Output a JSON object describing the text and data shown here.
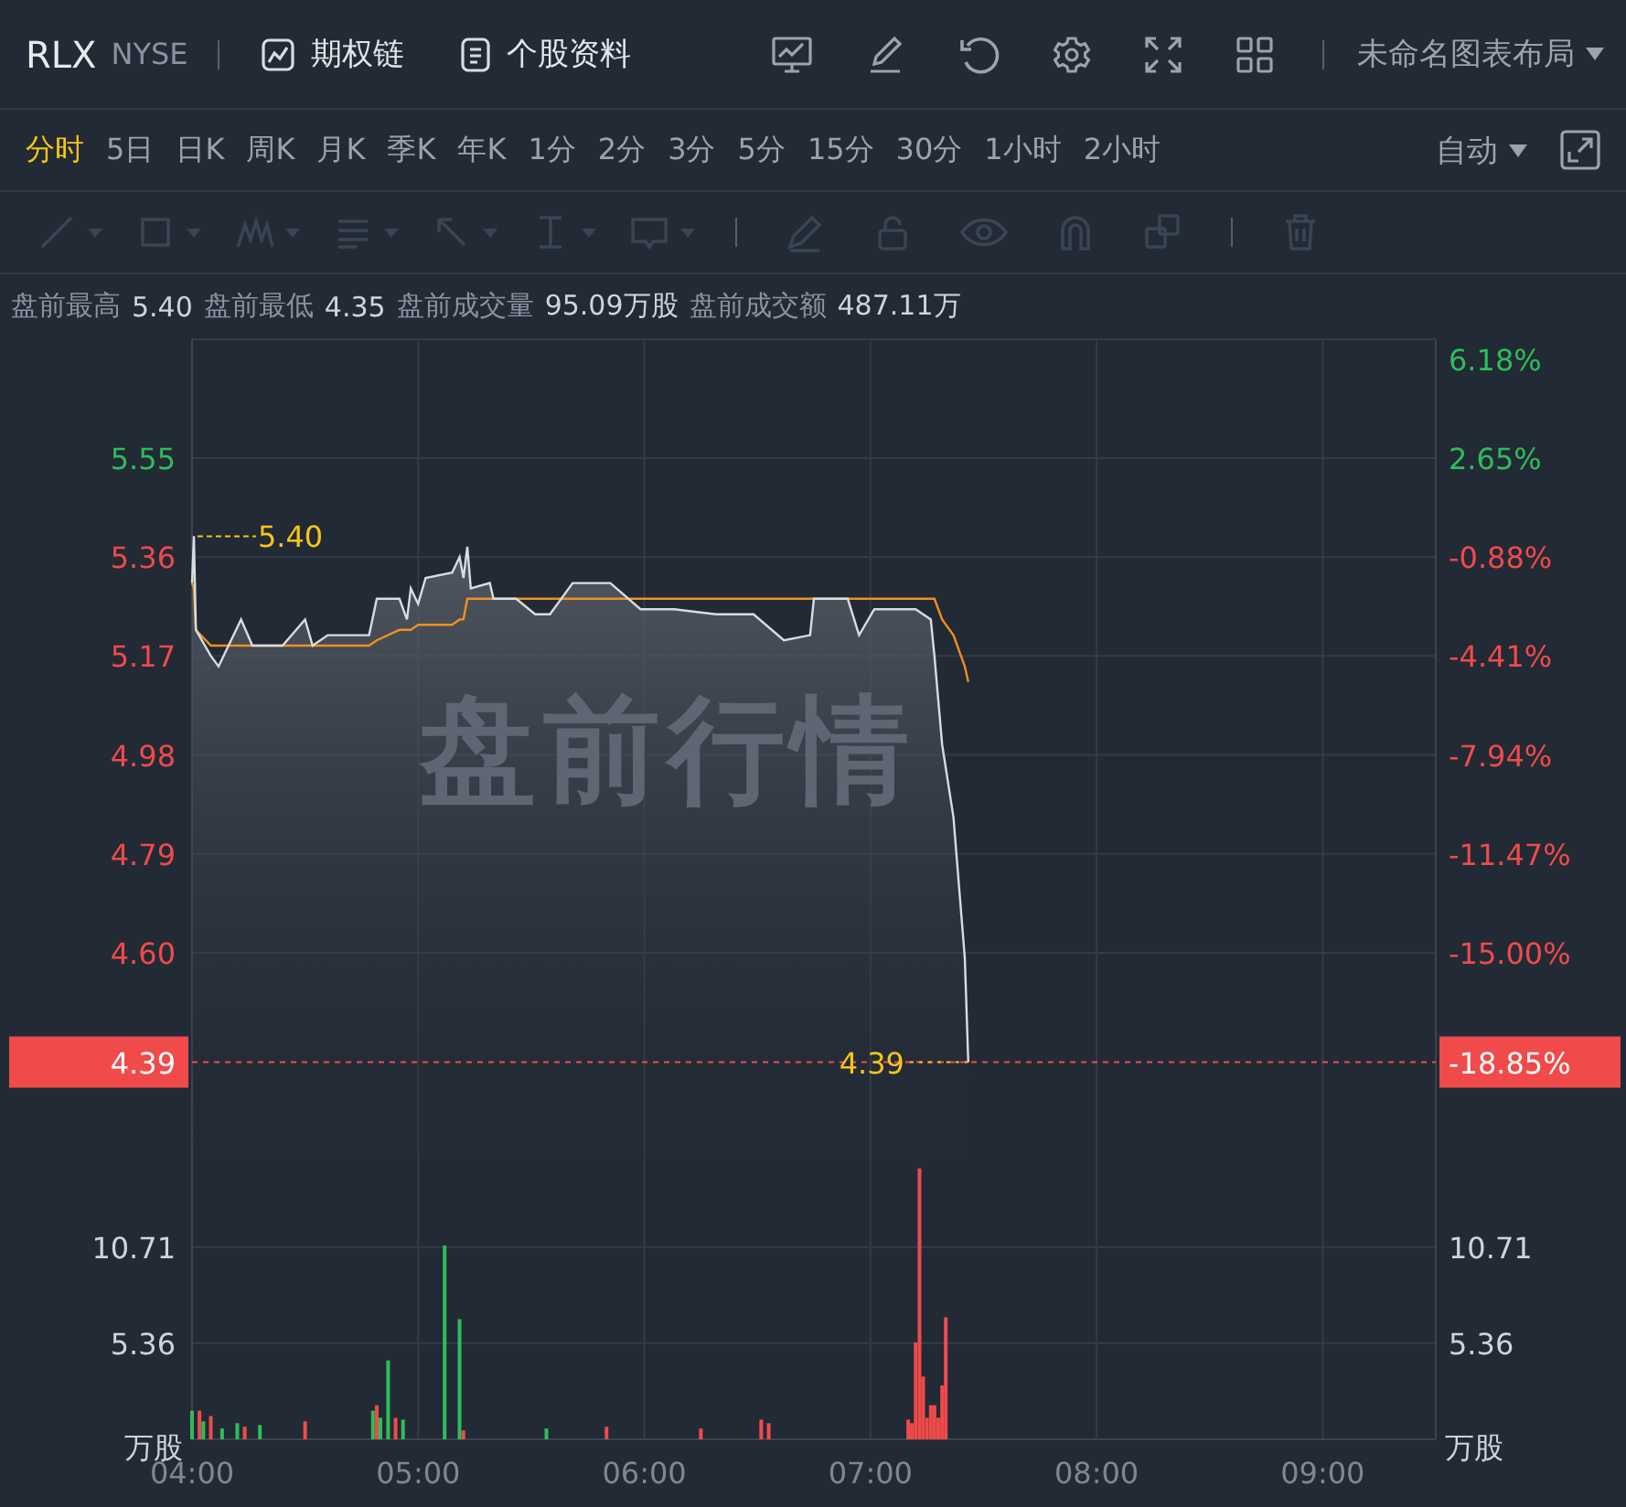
{
  "header": {
    "symbol": "RLX",
    "exchange": "NYSE",
    "links": [
      {
        "label": "期权链"
      },
      {
        "label": "个股资料"
      }
    ],
    "layout_menu": "未命名图表布局"
  },
  "periods": [
    {
      "label": "分时",
      "selected": true
    },
    {
      "label": "5日",
      "selected": false
    },
    {
      "label": "日K",
      "selected": false
    },
    {
      "label": "周K",
      "selected": false
    },
    {
      "label": "月K",
      "selected": false
    },
    {
      "label": "季K",
      "selected": false
    },
    {
      "label": "年K",
      "selected": false
    },
    {
      "label": "1分",
      "selected": false
    },
    {
      "label": "2分",
      "selected": false
    },
    {
      "label": "3分",
      "selected": false
    },
    {
      "label": "5分",
      "selected": false
    },
    {
      "label": "15分",
      "selected": false
    },
    {
      "label": "30分",
      "selected": false
    },
    {
      "label": "1小时",
      "selected": false
    },
    {
      "label": "2小时",
      "selected": false
    }
  ],
  "scale_menu": "自动",
  "drawing_toolbar": {
    "disabled": true
  },
  "stats": [
    {
      "label": "盘前最高",
      "value": "5.40"
    },
    {
      "label": "盘前最低",
      "value": "4.35"
    },
    {
      "label": "盘前成交量",
      "value": "95.09万股"
    },
    {
      "label": "盘前成交额",
      "value": "487.11万"
    }
  ],
  "price_chart": {
    "overlay_text": "盘前行情",
    "right_axis": [
      {
        "label": "6.18%",
        "color": "#2ebd5a"
      },
      {
        "label": "2.65%",
        "color": "#2ebd5a"
      },
      {
        "label": "-0.88%",
        "color": "#f04a4a"
      },
      {
        "label": "-4.41%",
        "color": "#f04a4a"
      },
      {
        "label": "-7.94%",
        "color": "#f04a4a"
      },
      {
        "label": "-11.47%",
        "color": "#f04a4a"
      },
      {
        "label": "-15.00%",
        "color": "#f04a4a"
      }
    ],
    "price_tag": {
      "price": "4.39",
      "change": "-18.85%"
    },
    "chart_data": {
      "type": "line",
      "x": [
        4,
        4.008,
        4.017,
        4.083,
        4.117,
        4.217,
        4.267,
        4.4,
        4.5,
        4.533,
        4.6,
        4.783,
        4.817,
        4.917,
        4.95,
        4.967,
        5,
        5.033,
        5.15,
        5.183,
        5.2,
        5.217,
        5.233,
        5.317,
        5.333,
        5.433,
        5.517,
        5.583,
        5.683,
        5.85,
        5.983,
        6.133,
        6.317,
        6.483,
        6.617,
        6.733,
        6.75,
        6.9,
        6.95,
        7.017,
        7.2,
        7.233,
        7.267,
        7.283,
        7.317,
        7.367,
        7.417,
        7.433
      ],
      "series": [
        {
          "color": "#d9dde2",
          "values": [
            5.31,
            5.4,
            5.22,
            5.17,
            5.15,
            5.24,
            5.19,
            5.19,
            5.24,
            5.19,
            5.21,
            5.21,
            5.28,
            5.28,
            5.24,
            5.3,
            5.27,
            5.32,
            5.33,
            5.36,
            5.32,
            5.38,
            5.3,
            5.31,
            5.28,
            5.28,
            5.25,
            5.25,
            5.31,
            5.31,
            5.26,
            5.26,
            5.25,
            5.25,
            5.2,
            5.21,
            5.28,
            5.28,
            5.21,
            5.26,
            5.26,
            5.25,
            5.24,
            5.17,
            5.0,
            4.86,
            4.59,
            4.39
          ]
        },
        {
          "color": "#f0901e",
          "values": [
            5.31,
            5.3,
            5.22,
            5.19,
            5.19,
            5.19,
            5.19,
            5.19,
            5.19,
            5.19,
            5.19,
            5.19,
            5.2,
            5.22,
            5.22,
            5.22,
            5.23,
            5.23,
            5.23,
            5.24,
            5.24,
            5.28,
            5.28,
            5.28,
            5.28,
            5.28,
            5.28,
            5.28,
            5.28,
            5.28,
            5.28,
            5.28,
            5.28,
            5.28,
            5.28,
            5.28,
            5.28,
            5.28,
            5.28,
            5.28,
            5.28,
            5.28,
            5.28,
            5.28,
            5.24,
            5.21,
            5.15,
            5.12
          ]
        }
      ],
      "xlim": [
        4,
        9.5
      ],
      "ylim": [
        4.21,
        5.78
      ],
      "grid": true,
      "ref_lines": [
        {
          "axis": "y",
          "value": 4.39,
          "color": "#f04a4a"
        }
      ],
      "yticks": [
        {
          "value": 5.55,
          "label": "5.55"
        },
        {
          "value": 5.36,
          "label": "5.36"
        },
        {
          "value": 5.17,
          "label": "5.17"
        },
        {
          "value": 4.98,
          "label": "4.98"
        },
        {
          "value": 4.79,
          "label": "4.79"
        },
        {
          "value": 4.6,
          "label": "4.60"
        }
      ],
      "annotations": [
        {
          "text": "5.40",
          "x": 4.008,
          "y": 5.4
        },
        {
          "text": "4.39",
          "x": 7.433,
          "y": 4.39
        }
      ]
    }
  },
  "volume_chart": {
    "unit_left": "万股",
    "unit_right": "万股",
    "chart_data": {
      "type": "bar",
      "x": [
        4,
        4.033,
        4.05,
        4.083,
        4.133,
        4.2,
        4.233,
        4.3,
        4.5,
        4.8,
        4.817,
        4.833,
        4.867,
        4.9,
        4.933,
        5.117,
        5.183,
        5.2,
        5.567,
        5.833,
        6.25,
        6.517,
        6.55,
        7.167,
        7.183,
        7.2,
        7.217,
        7.233,
        7.25,
        7.267,
        7.283,
        7.3,
        7.317,
        7.333
      ],
      "series": [
        {
          "color": "#f04a4a",
          "values": [
            null,
            1.6,
            null,
            1.3,
            null,
            null,
            0.7,
            null,
            1.0,
            null,
            1.9,
            null,
            null,
            1.2,
            null,
            null,
            null,
            0.5,
            null,
            0.7,
            0.6,
            1.1,
            0.9,
            1.1,
            0.9,
            5.4,
            15.1,
            3.5,
            1.2,
            1.9,
            1.9,
            1.2,
            3.0,
            6.8
          ]
        },
        {
          "color": "#2ebd5a",
          "values": [
            1.6,
            null,
            1.0,
            null,
            0.6,
            0.9,
            null,
            0.8,
            null,
            1.6,
            null,
            1.2,
            4.4,
            null,
            1.1,
            10.8,
            6.7,
            null,
            0.6,
            null,
            null,
            null,
            null,
            null,
            null,
            null,
            null,
            null,
            null,
            null,
            null,
            null,
            null,
            null
          ]
        }
      ],
      "xlim": [
        4,
        9.5
      ],
      "ylim": [
        0,
        15.8
      ],
      "grid": true,
      "yticks": [
        {
          "value": 5.36,
          "label": "5.36"
        },
        {
          "value": 10.71,
          "label": "10.71"
        }
      ],
      "xticks": [
        {
          "value": 4,
          "label": "04:00"
        },
        {
          "value": 5,
          "label": "05:00"
        },
        {
          "value": 6,
          "label": "06:00"
        },
        {
          "value": 7,
          "label": "07:00"
        },
        {
          "value": 8,
          "label": "08:00"
        },
        {
          "value": 9,
          "label": "09:00"
        }
      ]
    }
  }
}
